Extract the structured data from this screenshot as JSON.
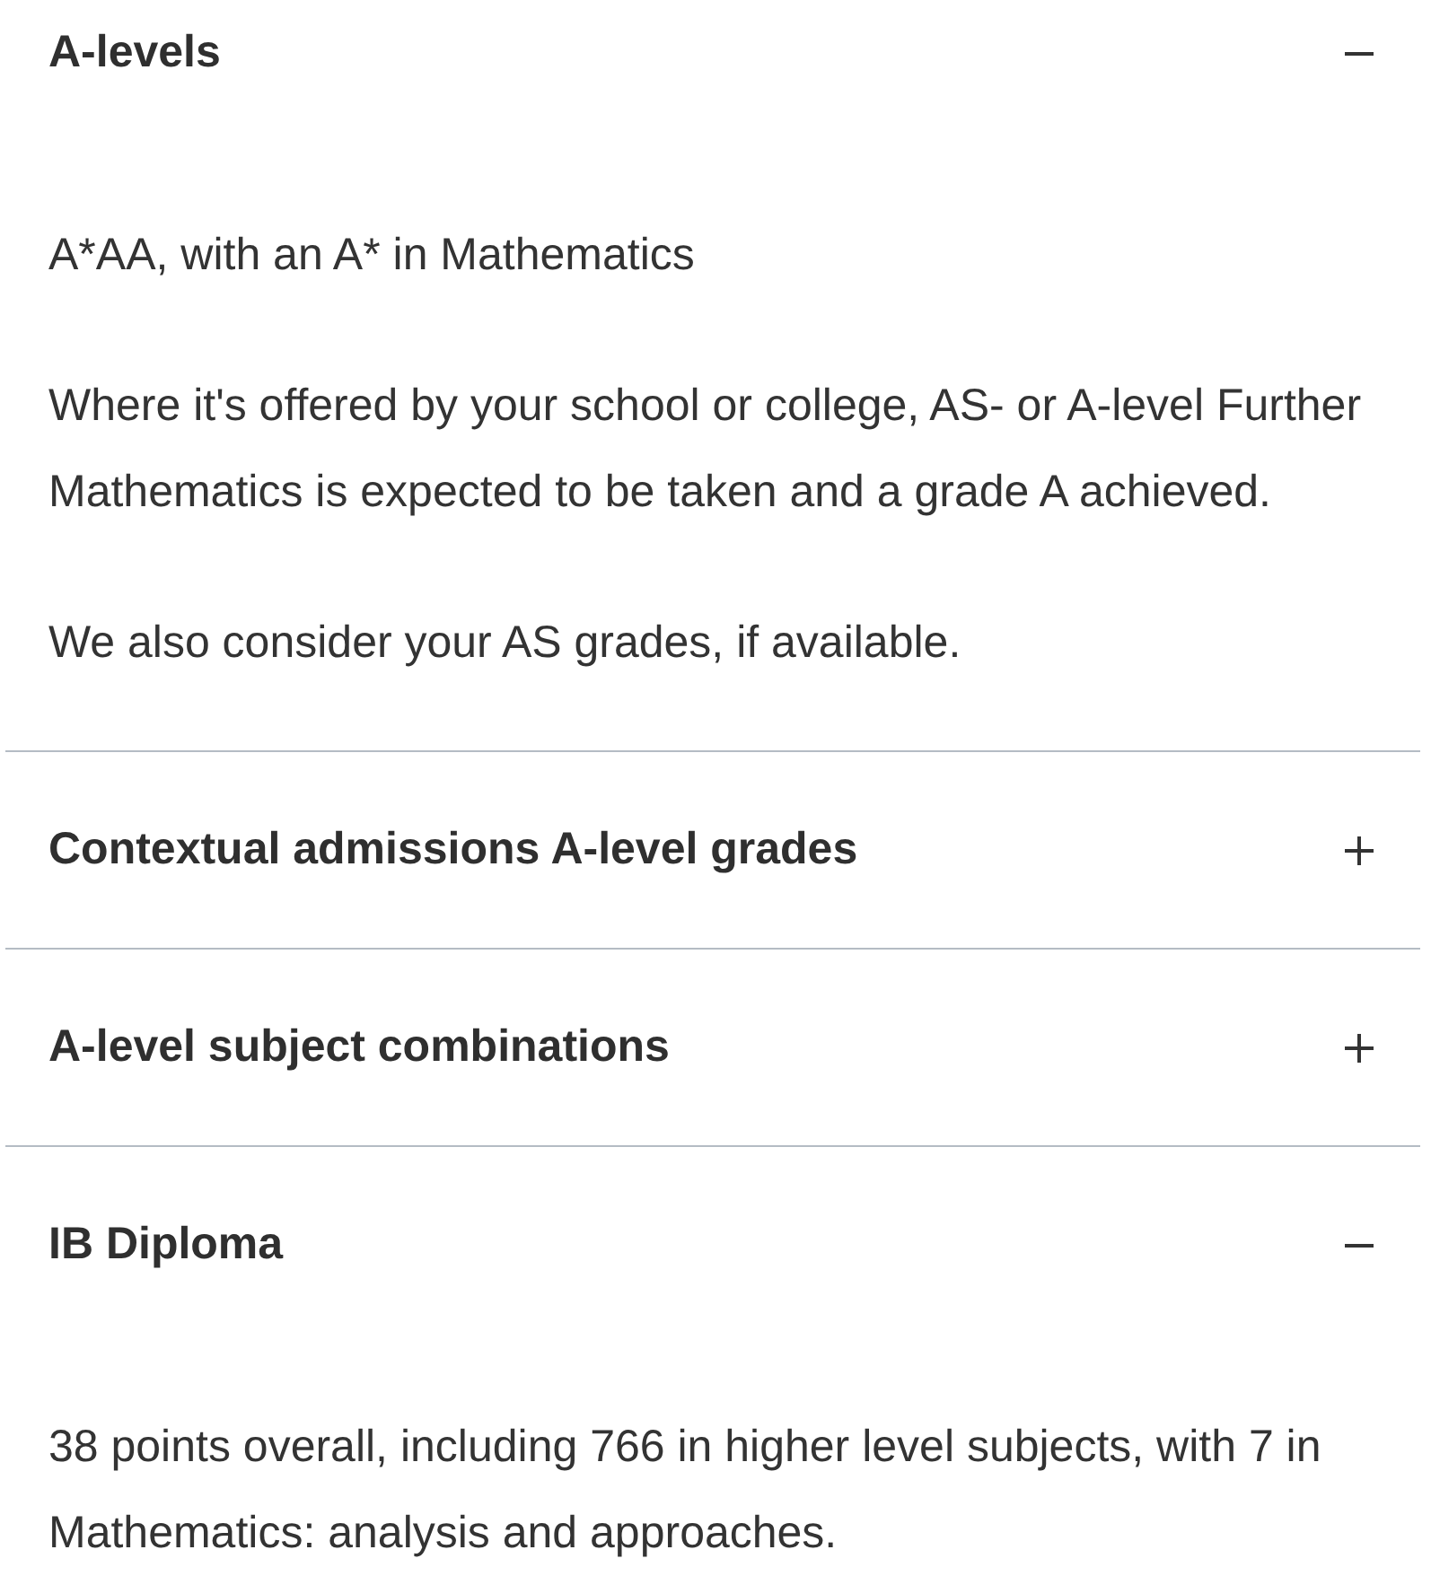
{
  "sections": [
    {
      "title": "A-levels",
      "expanded": true,
      "paragraphs": [
        "A*AA, with an A* in Mathematics",
        "Where it's offered by your school or college, AS- or A-level Further Mathematics is expected to be taken and a grade A achieved.",
        "We also consider your AS grades, if available."
      ]
    },
    {
      "title": "Contextual admissions A-level grades",
      "expanded": false
    },
    {
      "title": "A-level subject combinations",
      "expanded": false
    },
    {
      "title": "IB Diploma",
      "expanded": true,
      "paragraphs": [
        "38 points overall, including 766 in higher level subjects, with 7 in Mathematics: analysis and approaches."
      ]
    }
  ]
}
